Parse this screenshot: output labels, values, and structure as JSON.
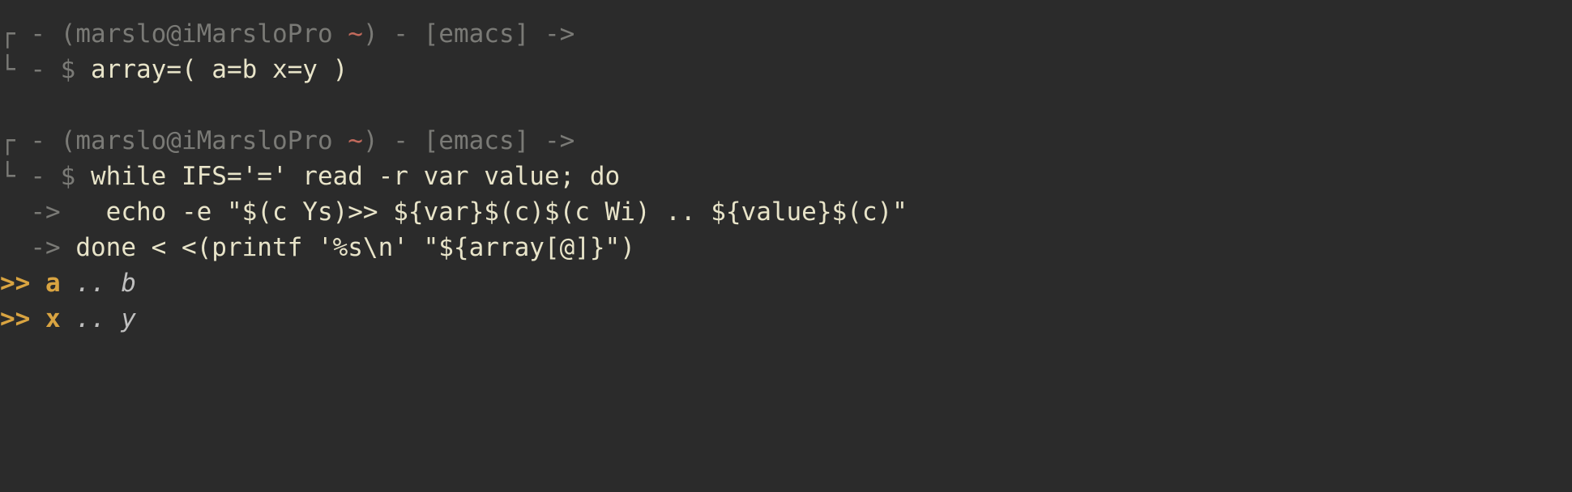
{
  "prompts": [
    {
      "bracket_top": "┌ -",
      "bracket_bot": "└ -",
      "open_paren": " (",
      "userhost": "marslo@iMarsloPro ",
      "tilde": "~",
      "close_paren": ")",
      "sep": " - ",
      "context_open": "[",
      "context": "emacs",
      "context_close": "]",
      "arrow": " ->",
      "dollar": " $ ",
      "command": "array=( a=b x=y )"
    },
    {
      "bracket_top": "┌ -",
      "bracket_bot": "└ -",
      "open_paren": " (",
      "userhost": "marslo@iMarsloPro ",
      "tilde": "~",
      "close_paren": ")",
      "sep": " - ",
      "context_open": "[",
      "context": "emacs",
      "context_close": "]",
      "arrow": " ->",
      "dollar": " $ ",
      "command": "while IFS='=' read -r var value; do",
      "cont": [
        {
          "marker": "  -> ",
          "text": "  echo -e \"$(c Ys)>> ${var}$(c)$(c Wi) .. ${value}$(c)\""
        },
        {
          "marker": "  -> ",
          "text": "done < <(printf '%s\\n' \"${array[@]}\")"
        }
      ]
    }
  ],
  "output": [
    {
      "marker": ">> ",
      "a": "a",
      "dots": " .. ",
      "b": "b"
    },
    {
      "marker": ">> ",
      "a": "x",
      "dots": " .. ",
      "b": "y"
    }
  ]
}
